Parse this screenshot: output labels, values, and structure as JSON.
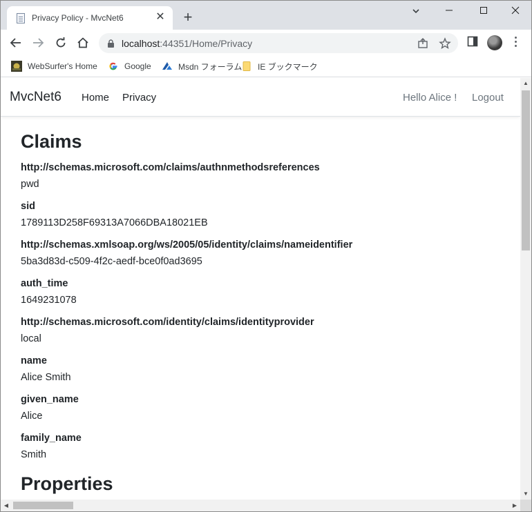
{
  "browser": {
    "tab_title": "Privacy Policy - MvcNet6",
    "tab_close": "✕",
    "new_tab": "+",
    "url_host": "localhost",
    "url_rest": ":44351/Home/Privacy",
    "bookmarks": [
      {
        "label": "WebSurfer's Home",
        "icon": "websurfer-icon"
      },
      {
        "label": "Google",
        "icon": "google-icon"
      },
      {
        "label": "Msdn フォーラム",
        "icon": "msdn-icon"
      },
      {
        "label": "IE ブックマーク",
        "icon": "folder-icon"
      }
    ]
  },
  "site": {
    "brand": "MvcNet6",
    "nav": [
      "Home",
      "Privacy"
    ],
    "greeting": "Hello Alice !",
    "logout": "Logout"
  },
  "main": {
    "heading": "Claims",
    "claims": [
      {
        "type": "http://schemas.microsoft.com/claims/authnmethodsreferences",
        "value": "pwd"
      },
      {
        "type": "sid",
        "value": "1789113D258F69313A7066DBA18021EB"
      },
      {
        "type": "http://schemas.xmlsoap.org/ws/2005/05/identity/claims/nameidentifier",
        "value": "5ba3d83d-c509-4f2c-aedf-bce0f0ad3695"
      },
      {
        "type": "auth_time",
        "value": "1649231078"
      },
      {
        "type": "http://schemas.microsoft.com/identity/claims/identityprovider",
        "value": "local"
      },
      {
        "type": "name",
        "value": "Alice Smith"
      },
      {
        "type": "given_name",
        "value": "Alice"
      },
      {
        "type": "family_name",
        "value": "Smith"
      }
    ],
    "properties_heading": "Properties"
  }
}
